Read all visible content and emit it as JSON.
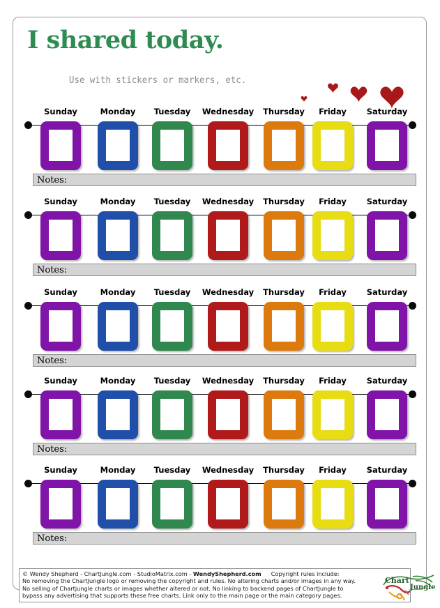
{
  "page": {
    "title": "I shared today.",
    "subtitle": "Use  with stickers or markers, etc."
  },
  "decor": {
    "hearts_icon": "heart-icon",
    "heart_color": "#a81818",
    "heart_count": 4,
    "logo_text_top": "Chart",
    "logo_text_bottom": "Jungle"
  },
  "days": [
    {
      "label": "Sunday",
      "color": "#8014a8"
    },
    {
      "label": "Monday",
      "color": "#1f4fa8"
    },
    {
      "label": "Tuesday",
      "color": "#31884e"
    },
    {
      "label": "Wednesday",
      "color": "#b01a1a"
    },
    {
      "label": "Thursday",
      "color": "#dd7a0e"
    },
    {
      "label": "Friday",
      "color": "#e8dc12"
    },
    {
      "label": "Saturday",
      "color": "#8014a8"
    }
  ],
  "notes_label": "Notes:",
  "weeks": [
    {
      "index": 1
    },
    {
      "index": 2
    },
    {
      "index": 3
    },
    {
      "index": 4
    },
    {
      "index": 5
    }
  ],
  "footer": {
    "line1_a": "© Wendy Shepherd - ChartJungle.com - StudioMatrix.com - ",
    "line1_b": "WendyShepherd.com",
    "line1_c": "Copyright rules include:",
    "line2": "No removing the ChartJungle logo or removing the copyright and rules. No altering charts and/or images in any way.",
    "line3": "No selling of Chartjungle charts or images whether altered or not. No linking to backend pages of ChartJungle to",
    "line4": "bypass any advertising that supports these free charts. Link only to the main page or the main category pages."
  },
  "colors": {
    "title_green": "#2e8b51",
    "subtitle_gray": "#8c8c8c",
    "notes_gray": "#d4d4d4",
    "border_gray": "#8e8e8e"
  }
}
